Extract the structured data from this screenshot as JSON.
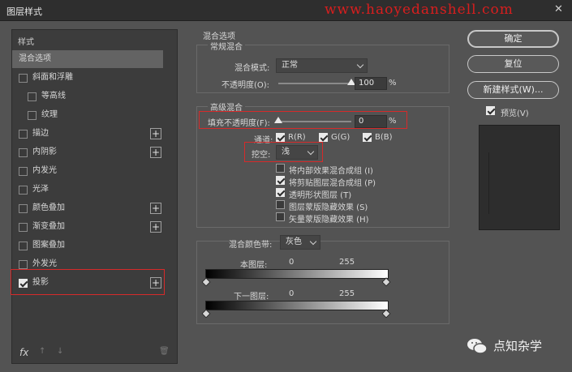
{
  "window": {
    "title": "图层样式",
    "watermark": "www.haoyedanshell.com",
    "close_glyph": "✕"
  },
  "sidebar": {
    "header": "样式",
    "items": [
      {
        "label": "混合选项",
        "checkbox": false,
        "checked": false,
        "plus": false,
        "selected": true,
        "indent": false
      },
      {
        "label": "斜面和浮雕",
        "checkbox": true,
        "checked": false,
        "plus": false,
        "selected": false,
        "indent": false
      },
      {
        "label": "等高线",
        "checkbox": true,
        "checked": false,
        "plus": false,
        "selected": false,
        "indent": true
      },
      {
        "label": "纹理",
        "checkbox": true,
        "checked": false,
        "plus": false,
        "selected": false,
        "indent": true
      },
      {
        "label": "描边",
        "checkbox": true,
        "checked": false,
        "plus": true,
        "selected": false,
        "indent": false
      },
      {
        "label": "内阴影",
        "checkbox": true,
        "checked": false,
        "plus": true,
        "selected": false,
        "indent": false
      },
      {
        "label": "内发光",
        "checkbox": true,
        "checked": false,
        "plus": false,
        "selected": false,
        "indent": false
      },
      {
        "label": "光泽",
        "checkbox": true,
        "checked": false,
        "plus": false,
        "selected": false,
        "indent": false
      },
      {
        "label": "颜色叠加",
        "checkbox": true,
        "checked": false,
        "plus": true,
        "selected": false,
        "indent": false
      },
      {
        "label": "渐变叠加",
        "checkbox": true,
        "checked": false,
        "plus": true,
        "selected": false,
        "indent": false
      },
      {
        "label": "图案叠加",
        "checkbox": true,
        "checked": false,
        "plus": false,
        "selected": false,
        "indent": false
      },
      {
        "label": "外发光",
        "checkbox": true,
        "checked": false,
        "plus": false,
        "selected": false,
        "indent": false
      },
      {
        "label": "投影",
        "checkbox": true,
        "checked": true,
        "plus": true,
        "selected": false,
        "indent": false
      }
    ],
    "plus_glyph": "+",
    "fx_label": "fx",
    "up_glyph": "↑",
    "down_glyph": "↓",
    "trash_glyph": "🗑"
  },
  "blend": {
    "section_title": "混合选项",
    "general_title": "常规混合",
    "mode_label": "混合模式:",
    "mode_value": "正常",
    "opacity_label": "不透明度(O):",
    "opacity_value": "100",
    "opacity_fraction": 1.0,
    "percent": "%",
    "advanced_title": "高级混合",
    "fill_label": "填充不透明度(F):",
    "fill_value": "0",
    "fill_fraction": 0.0,
    "channels_label": "通道:",
    "channel_r": "R(R)",
    "channel_g": "G(G)",
    "channel_b": "B(B)",
    "knockout_label": "挖空:",
    "knockout_value": "浅",
    "options": [
      {
        "label": "将内部效果混合成组 (I)",
        "checked": false
      },
      {
        "label": "将剪贴图层混合成组 (P)",
        "checked": true
      },
      {
        "label": "透明形状图层 (T)",
        "checked": true
      },
      {
        "label": "图层蒙版隐藏效果 (S)",
        "checked": false
      },
      {
        "label": "矢量蒙版隐藏效果 (H)",
        "checked": false
      }
    ],
    "blendif_label": "混合颜色带:",
    "blendif_value": "灰色",
    "this_layer_label": "本图层:",
    "this_low": "0",
    "this_high": "255",
    "under_layer_label": "下一图层:",
    "under_low": "0",
    "under_high": "255"
  },
  "buttons": {
    "ok": "确定",
    "reset": "复位",
    "new_style": "新建样式(W)...",
    "preview_label": "预览(V)"
  },
  "brand": {
    "text": "点知杂学"
  },
  "colors": {
    "highlight_box": "#d62a2a",
    "watermark": "#d81e1e"
  }
}
